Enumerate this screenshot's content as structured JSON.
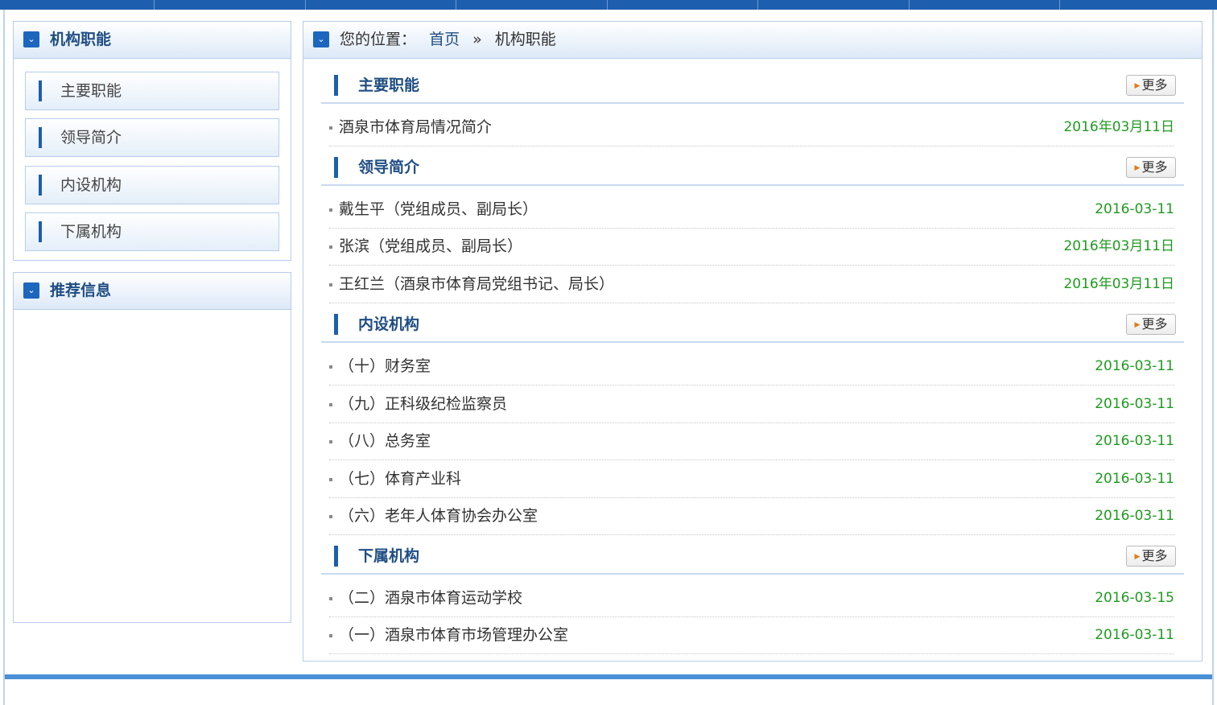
{
  "sidebar": {
    "title": "机构职能",
    "items": [
      {
        "label": "主要职能"
      },
      {
        "label": "领导简介"
      },
      {
        "label": "内设机构"
      },
      {
        "label": "下属机构"
      }
    ],
    "recommend_title": "推荐信息"
  },
  "breadcrumb": {
    "prefix": "您的位置：",
    "home": "首页",
    "sep": "»",
    "current": "机构职能"
  },
  "sections": [
    {
      "title": "主要职能",
      "more": "更多",
      "items": [
        {
          "text": "酒泉市体育局情况简介",
          "date": "2016年03月11日"
        }
      ]
    },
    {
      "title": "领导简介",
      "more": "更多",
      "items": [
        {
          "text": "戴生平（党组成员、副局长）",
          "date": "2016-03-11"
        },
        {
          "text": "张滨（党组成员、副局长）",
          "date": "2016年03月11日"
        },
        {
          "text": "王红兰（酒泉市体育局党组书记、局长）",
          "date": "2016年03月11日"
        }
      ]
    },
    {
      "title": "内设机构",
      "more": "更多",
      "items": [
        {
          "text": "（十）财务室",
          "date": "2016-03-11"
        },
        {
          "text": "（九）正科级纪检监察员",
          "date": "2016-03-11"
        },
        {
          "text": "（八）总务室",
          "date": "2016-03-11"
        },
        {
          "text": "（七）体育产业科",
          "date": "2016-03-11"
        },
        {
          "text": "（六）老年人体育协会办公室",
          "date": "2016-03-11"
        }
      ]
    },
    {
      "title": "下属机构",
      "more": "更多",
      "items": [
        {
          "text": "（二）酒泉市体育运动学校",
          "date": "2016-03-15"
        },
        {
          "text": "（一）酒泉市体育市场管理办公室",
          "date": "2016-03-11"
        }
      ]
    }
  ],
  "colors": {
    "brand": "#1d5fae",
    "title": "#1f4d83",
    "date": "#1e9b1e",
    "more_arrow": "#e07a1c"
  },
  "icons": {
    "panel": "chevron-down-icon",
    "more": "arrow-right-icon"
  }
}
